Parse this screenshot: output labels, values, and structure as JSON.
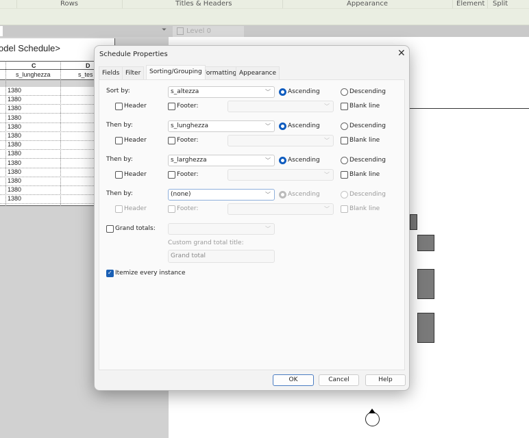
{
  "ribbon": {
    "groups": [
      "Rows",
      "Titles & Headers",
      "Appearance",
      "Element",
      "Split"
    ]
  },
  "viewbar": {
    "view_tab": "Level 0",
    "dropdown_icon": "filter-dropdown-icon"
  },
  "schedule": {
    "title": "odel Schedule>",
    "columns": [
      "C",
      "D"
    ],
    "fields": [
      "s_lunghezza",
      "s_tes"
    ],
    "values": [
      "1380",
      "1380",
      "1380",
      "1380",
      "1380",
      "1380",
      "1380",
      "1380",
      "1380",
      "1380",
      "1380",
      "1380",
      "1380"
    ]
  },
  "dialog": {
    "title": "Schedule Properties",
    "tabs": [
      "Fields",
      "Filter",
      "Sorting/Grouping",
      "Formatting",
      "Appearance"
    ],
    "active_tab": "Sorting/Grouping",
    "sort_rows": [
      {
        "label": "Sort by:",
        "field": "s_altezza",
        "ascending": "Ascending",
        "descending": "Descending",
        "order": "ascending",
        "header": "Header",
        "footer": "Footer:",
        "blank_line": "Blank line",
        "enabled": true
      },
      {
        "label": "Then by:",
        "field": "s_lunghezza",
        "ascending": "Ascending",
        "descending": "Descending",
        "order": "ascending",
        "header": "Header",
        "footer": "Footer:",
        "blank_line": "Blank line",
        "enabled": true
      },
      {
        "label": "Then by:",
        "field": "s_larghezza",
        "ascending": "Ascending",
        "descending": "Descending",
        "order": "ascending",
        "header": "Header",
        "footer": "Footer:",
        "blank_line": "Blank line",
        "enabled": true
      },
      {
        "label": "Then by:",
        "field": "(none)",
        "ascending": "Ascending",
        "descending": "Descending",
        "order": "ascending",
        "header": "Header",
        "footer": "Footer:",
        "blank_line": "Blank line",
        "enabled": false
      }
    ],
    "grand_totals": {
      "label": "Grand totals:",
      "checked": false,
      "custom_title_label": "Custom grand total title:",
      "custom_title_value": "Grand total"
    },
    "itemize": {
      "label": "Itemize every instance",
      "checked": true
    },
    "buttons": {
      "ok": "OK",
      "cancel": "Cancel",
      "help": "Help"
    }
  },
  "colors": {
    "accent": "#0f5cbf",
    "ribbon": "#eaeee2"
  }
}
